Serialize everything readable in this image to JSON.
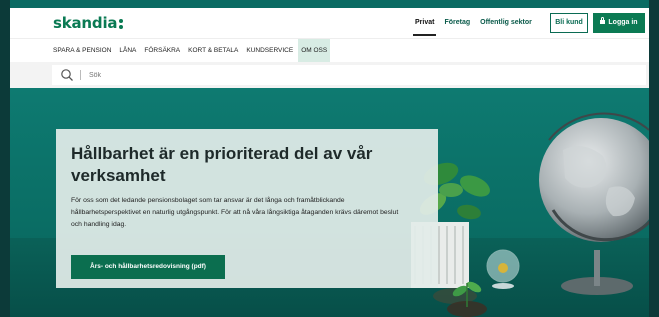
{
  "header": {
    "logo_text": "skandia",
    "segments": [
      "Privat",
      "Företag",
      "Offentlig sektor"
    ],
    "active_segment": "Privat",
    "bli_kund": "Bli kund",
    "logga_in": "Logga in"
  },
  "nav": {
    "items": [
      "SPARA & PENSION",
      "LÅNA",
      "FÖRSÄKRA",
      "KORT & BETALA",
      "KUNDSERVICE",
      "OM OSS"
    ],
    "active": "OM OSS"
  },
  "search": {
    "placeholder": "Sök"
  },
  "hero": {
    "title": "Hållbarhet är en prioriterad del av vår verksamhet",
    "body": "För oss som det ledande pensionsbolaget som tar ansvar är det långa och framåtblickande hållbarhetsperspektivet en naturlig utgångspunkt. För att nå våra långsiktiga åtaganden krävs däremot beslut och handling idag.",
    "button": "Års- och hållbarhetsredovisning (pdf)"
  },
  "colors": {
    "brand": "#0a7a53",
    "hero_bg": "#0a6b63",
    "nav_active_bg": "#d8ece4"
  },
  "icons": [
    "search-icon",
    "lock-icon",
    "globe-image",
    "plant-image",
    "glass-orb-image"
  ]
}
